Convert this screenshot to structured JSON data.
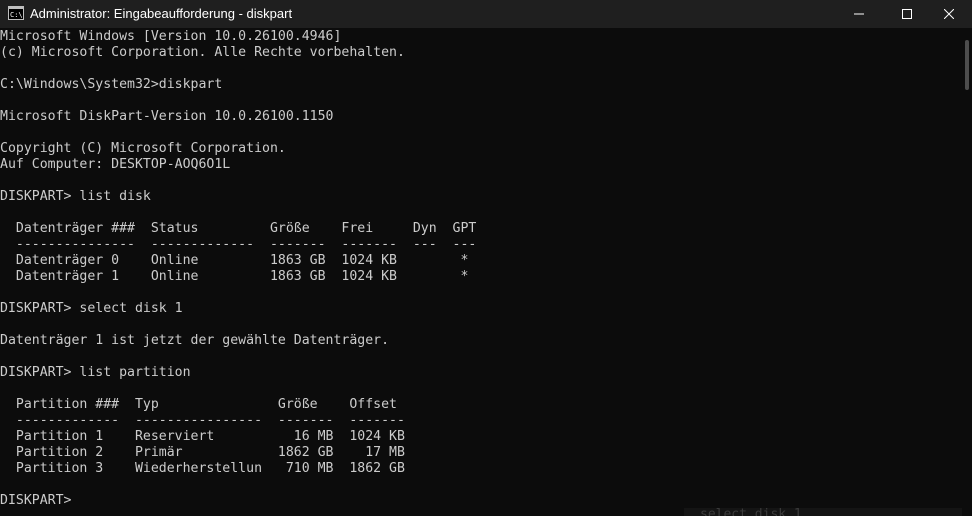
{
  "window": {
    "title": "Administrator: Eingabeaufforderung - diskpart",
    "icon": "cmd-icon",
    "controls": {
      "minimize": "minimize-icon",
      "maximize": "maximize-icon",
      "close": "close-icon"
    }
  },
  "terminal": {
    "lines": [
      "Microsoft Windows [Version 10.0.26100.4946]",
      "(c) Microsoft Corporation. Alle Rechte vorbehalten.",
      "",
      "C:\\Windows\\System32>diskpart",
      "",
      "Microsoft DiskPart-Version 10.0.26100.1150",
      "",
      "Copyright (C) Microsoft Corporation.",
      "Auf Computer: DESKTOP-AOQ6O1L",
      "",
      "DISKPART> list disk",
      "",
      "  Datenträger ###  Status         Größe    Frei     Dyn  GPT",
      "  ---------------  -------------  -------  -------  ---  ---",
      "  Datenträger 0    Online         1863 GB  1024 KB        *",
      "  Datenträger 1    Online         1863 GB  1024 KB        *",
      "",
      "DISKPART> select disk 1",
      "",
      "Datenträger 1 ist jetzt der gewählte Datenträger.",
      "",
      "DISKPART> list partition",
      "",
      "  Partition ###  Typ               Größe    Offset",
      "  -------------  ----------------  -------  -------",
      "  Partition 1    Reserviert          16 MB  1024 KB",
      "  Partition 2    Primär            1862 GB    17 MB",
      "  Partition 3    Wiederherstellun   710 MB  1862 GB",
      "",
      "DISKPART>"
    ]
  },
  "ghost_suggestion": "select disk 1",
  "colors": {
    "background": "#0c0c0c",
    "titlebar": "#1f1f1f",
    "text": "#cccccc",
    "title_text": "#ffffff"
  }
}
